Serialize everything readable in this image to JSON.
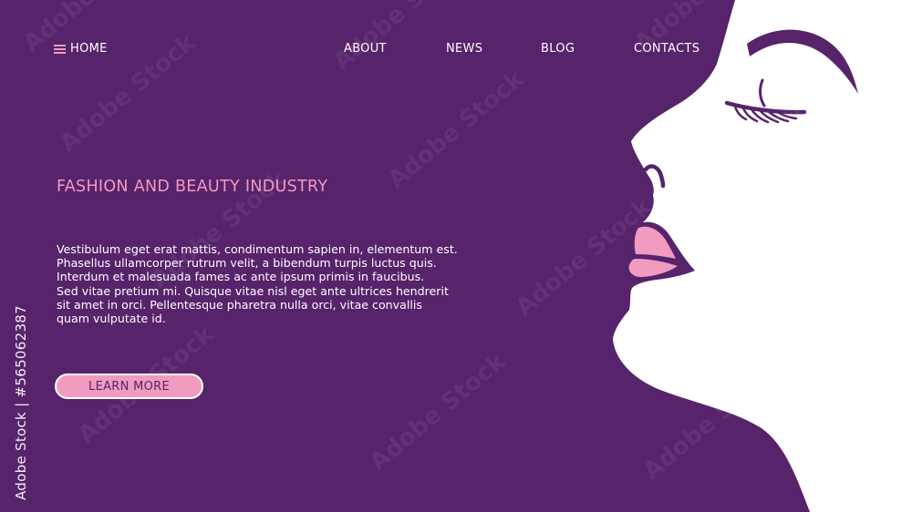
{
  "nav": {
    "home_label": "HOME",
    "items": [
      {
        "label": "ABOUT"
      },
      {
        "label": "NEWS"
      },
      {
        "label": "BLOG"
      },
      {
        "label": "CONTACTS"
      }
    ]
  },
  "hero": {
    "headline": "FASHION AND BEAUTY INDUSTRY",
    "body_lines": [
      "Vestibulum eget erat mattis, condimentum sapien in, elementum est.",
      "Phasellus ullamcorper rutrum velit, a bibendum turpis luctus quis.",
      "Interdum et malesuada fames ac ante ipsum primis in faucibus.",
      "Sed vitae pretium mi. Quisque vitae nisl eget ante ultrices hendrerit",
      "sit amet in orci. Pellentesque pharetra nulla orci, vitae convallis",
      "quam vulputate id."
    ],
    "cta_label": "LEARN MORE"
  },
  "watermark": {
    "side_text": "Adobe Stock | #565062387",
    "tile_text": "Adobe Stock"
  },
  "colors": {
    "background": "#57236b",
    "accent_pink": "#f09bbf",
    "white": "#ffffff"
  },
  "icons": {
    "menu": "hamburger-menu-icon"
  }
}
